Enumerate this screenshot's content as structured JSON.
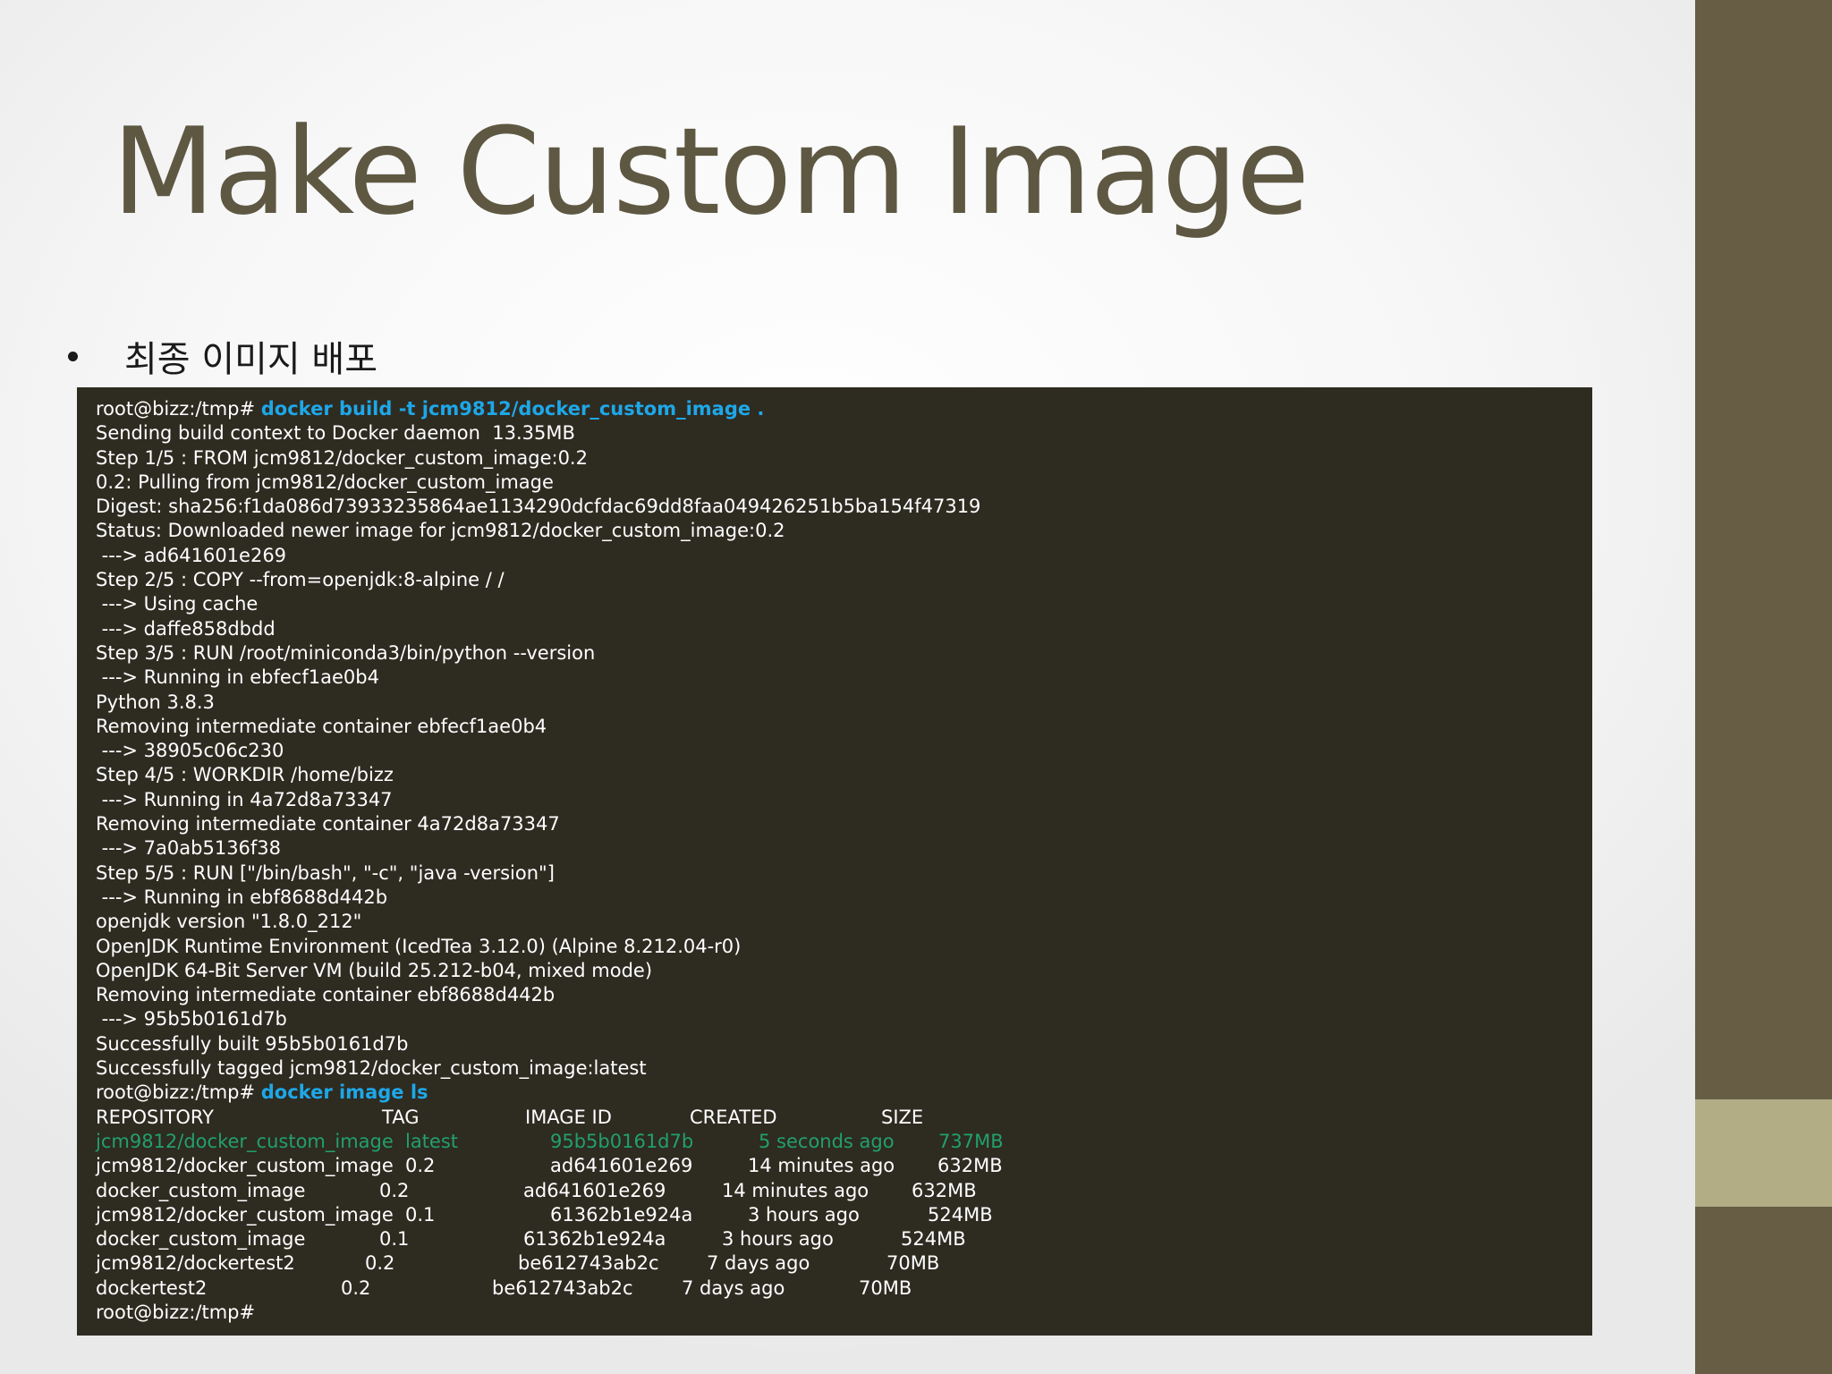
{
  "colors": {
    "title": "#5e5843",
    "terminal_bg": "#2e2b21",
    "terminal_text": "#ffffff",
    "command": "#1ea7e8",
    "highlight_row": "#22a06b",
    "side_band": "#675d45",
    "side_accent": "#b3ad86"
  },
  "slide": {
    "title": "Make Custom Image",
    "bullet": "최종 이미지 배포"
  },
  "terminal": {
    "prompt1": "root@bizz:/tmp# ",
    "command1": "docker build -t jcm9812/docker_custom_image .",
    "build_output": [
      "Sending build context to Docker daemon  13.35MB",
      "Step 1/5 : FROM jcm9812/docker_custom_image:0.2",
      "0.2: Pulling from jcm9812/docker_custom_image",
      "Digest: sha256:f1da086d73933235864ae1134290dcfdac69dd8faa049426251b5ba154f47319",
      "Status: Downloaded newer image for jcm9812/docker_custom_image:0.2",
      " ---> ad641601e269",
      "Step 2/5 : COPY --from=openjdk:8-alpine / /",
      " ---> Using cache",
      " ---> daffe858dbdd",
      "Step 3/5 : RUN /root/miniconda3/bin/python --version",
      " ---> Running in ebfecf1ae0b4",
      "Python 3.8.3",
      "Removing intermediate container ebfecf1ae0b4",
      " ---> 38905c06c230",
      "Step 4/5 : WORKDIR /home/bizz",
      " ---> Running in 4a72d8a73347",
      "Removing intermediate container 4a72d8a73347",
      " ---> 7a0ab5136f38",
      "Step 5/5 : RUN [\"/bin/bash\", \"-c\", \"java -version\"]",
      " ---> Running in ebf8688d442b",
      "openjdk version \"1.8.0_212\"",
      "OpenJDK Runtime Environment (IcedTea 3.12.0) (Alpine 8.212.04-r0)",
      "OpenJDK 64-Bit Server VM (build 25.212-b04, mixed mode)",
      "Removing intermediate container ebf8688d442b",
      " ---> 95b5b0161d7b",
      "Successfully built 95b5b0161d7b",
      "Successfully tagged jcm9812/docker_custom_image:latest"
    ],
    "prompt2": "root@bizz:/tmp# ",
    "command2": "docker image ls",
    "headers": [
      "REPOSITORY",
      "TAG",
      "IMAGE ID",
      "CREATED",
      "SIZE"
    ],
    "rows": [
      [
        "jcm9812/docker_custom_image",
        "latest",
        "95b5b0161d7b",
        "5 seconds ago",
        "737MB"
      ],
      [
        "jcm9812/docker_custom_image",
        "0.2",
        "ad641601e269",
        "14 minutes ago",
        "632MB"
      ],
      [
        "docker_custom_image",
        "0.2",
        "ad641601e269",
        "14 minutes ago",
        "632MB"
      ],
      [
        "jcm9812/docker_custom_image",
        "0.1",
        "61362b1e924a",
        "3 hours ago",
        "524MB"
      ],
      [
        "docker_custom_image",
        "0.1",
        "61362b1e924a",
        "3 hours ago",
        "524MB"
      ],
      [
        "jcm9812/dockertest2",
        "0.2",
        "be612743ab2c",
        "7 days ago",
        "70MB"
      ],
      [
        "dockertest2",
        "0.2",
        "be612743ab2c",
        "7 days ago",
        "70MB"
      ]
    ],
    "final_prompt": "root@bizz:/tmp#"
  }
}
